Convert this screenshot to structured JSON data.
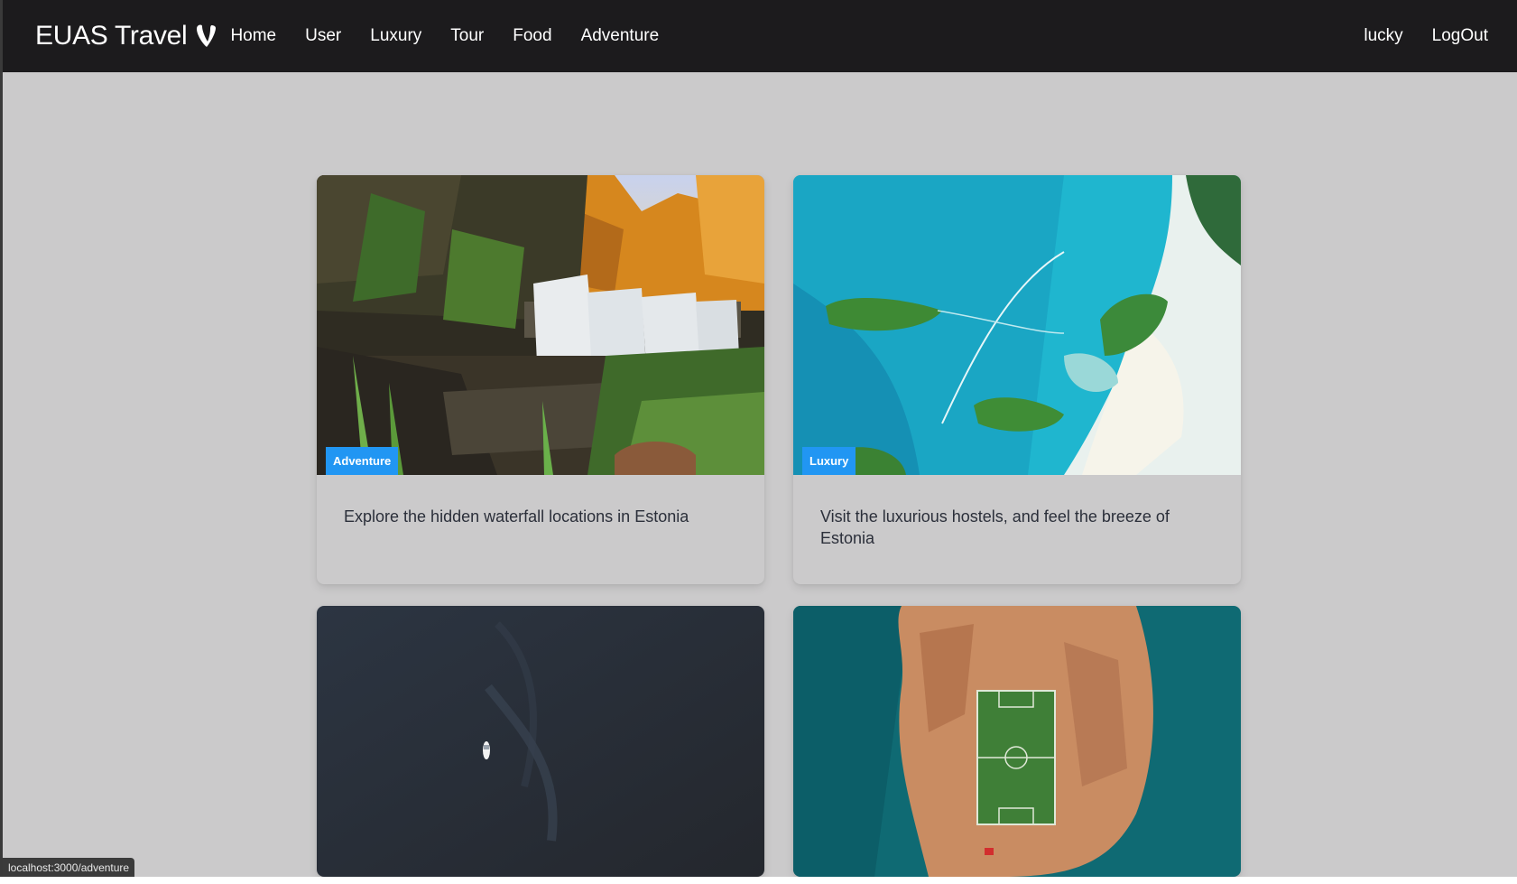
{
  "brand": {
    "name": "EUAS Travel",
    "icon": "typo3-logo-icon"
  },
  "nav": {
    "links": [
      "Home",
      "User",
      "Luxury",
      "Tour",
      "Food",
      "Adventure"
    ],
    "user": "lucky",
    "logout": "LogOut"
  },
  "cards": [
    {
      "badge": "Adventure",
      "title": "Explore the hidden waterfall locations in Estonia",
      "image": "waterfall-forest"
    },
    {
      "badge": "Luxury",
      "title": "Visit the luxurious hostels, and feel the breeze of Estonia",
      "image": "turquoise-sea-islands"
    },
    {
      "badge": "",
      "title": "",
      "image": "dark-ocean-boat"
    },
    {
      "badge": "",
      "title": "",
      "image": "island-football-field"
    }
  ],
  "status_bar": {
    "url": "localhost:3000/adventure"
  },
  "colors": {
    "navbar": "#1c1b1d",
    "page_bg": "#cbcacb",
    "badge": "#2196f3",
    "card_text": "#2b2f3a"
  }
}
